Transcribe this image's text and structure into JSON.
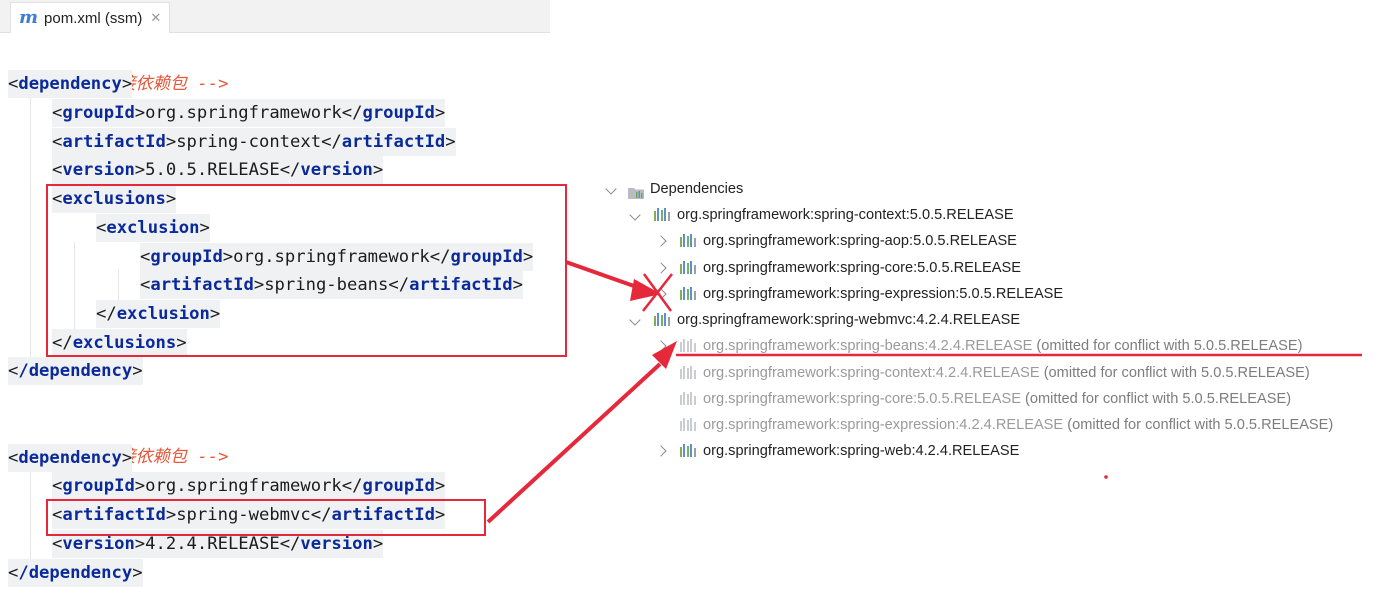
{
  "tab": {
    "icon": "m",
    "title": "pom.xml (ssm)",
    "close": "✕"
  },
  "code": {
    "comment1": "<!-- 直接依赖包 -->",
    "comment2": "<!-- 直接依赖包 -->",
    "dep1": {
      "open": "dependency",
      "groupId_tag": "groupId",
      "groupId": "org.springframework",
      "artifactId_tag": "artifactId",
      "artifactId": "spring-context",
      "version_tag": "version",
      "version": "5.0.5.RELEASE",
      "exclusions_tag": "exclusions",
      "exclusion_tag": "exclusion",
      "excl_groupId": "org.springframework",
      "excl_artifactId": "spring-beans",
      "close": "/dependency"
    },
    "dep2": {
      "open": "dependency",
      "groupId_tag": "groupId",
      "groupId": "org.springframework",
      "artifactId_tag": "artifactId",
      "artifactId": "spring-webmvc",
      "version_tag": "version",
      "version": "4.2.4.RELEASE",
      "close": "/dependency"
    }
  },
  "tree": {
    "root": "Dependencies",
    "items": [
      {
        "label": "org.springframework:spring-context:5.0.5.RELEASE",
        "note": "",
        "omitted": false,
        "expanded": true,
        "level": 1
      },
      {
        "label": "org.springframework:spring-aop:5.0.5.RELEASE",
        "note": "",
        "omitted": false,
        "expanded": false,
        "level": 2
      },
      {
        "label": "org.springframework:spring-core:5.0.5.RELEASE",
        "note": "",
        "omitted": false,
        "expanded": false,
        "level": 2
      },
      {
        "label": "org.springframework:spring-expression:5.0.5.RELEASE",
        "note": "",
        "omitted": false,
        "expanded": false,
        "level": 2
      },
      {
        "label": "org.springframework:spring-webmvc:4.2.4.RELEASE",
        "note": "",
        "omitted": false,
        "expanded": true,
        "level": 1
      },
      {
        "label": "org.springframework:spring-beans:4.2.4.RELEASE",
        "note": "(omitted for conflict with 5.0.5.RELEASE)",
        "omitted": true,
        "expanded": false,
        "level": 2
      },
      {
        "label": "org.springframework:spring-context:4.2.4.RELEASE",
        "note": "(omitted for conflict with 5.0.5.RELEASE)",
        "omitted": true,
        "level": 2
      },
      {
        "label": "org.springframework:spring-core:5.0.5.RELEASE",
        "note": "(omitted for conflict with 5.0.5.RELEASE)",
        "omitted": true,
        "level": 2
      },
      {
        "label": "org.springframework:spring-expression:4.2.4.RELEASE",
        "note": "(omitted for conflict with 5.0.5.RELEASE)",
        "omitted": true,
        "level": 2
      },
      {
        "label": "org.springframework:spring-web:4.2.4.RELEASE",
        "note": "",
        "omitted": false,
        "expanded": false,
        "level": 2
      }
    ]
  },
  "colors": {
    "annotation_red": "#e5283a",
    "xml_tag": "#0b2a9a",
    "comment": "#e5583a",
    "omitted_text": "#9a9a9a"
  }
}
